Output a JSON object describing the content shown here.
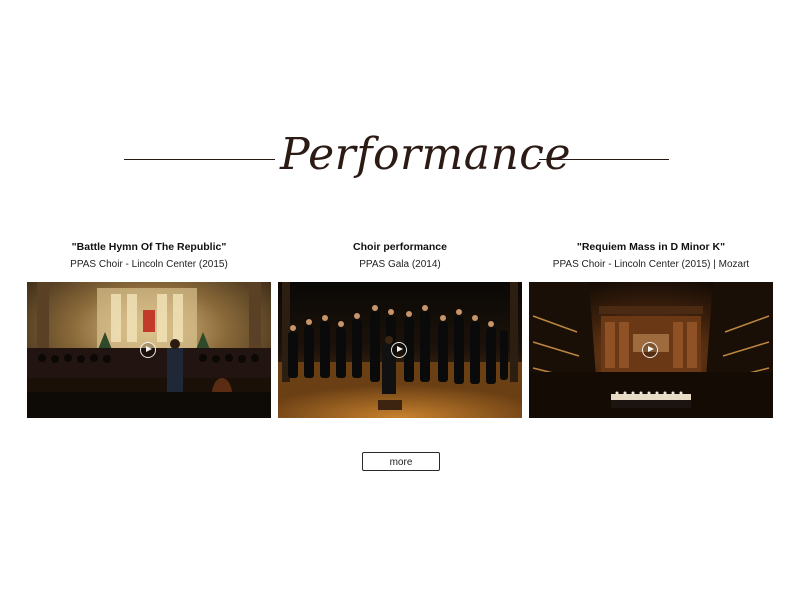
{
  "section": {
    "title": "Performance"
  },
  "videos": [
    {
      "title": "\"Battle Hymn Of The Republic\"",
      "subtitle": "PPAS Choir - Lincoln Center (2015)",
      "thumbnail_icon": "play-icon"
    },
    {
      "title": "Choir performance",
      "subtitle": "PPAS Gala (2014)",
      "thumbnail_icon": "play-icon"
    },
    {
      "title": "\"Requiem Mass in D Minor K\"",
      "subtitle": "PPAS Choir - Lincoln Center (2015) | Mozart",
      "thumbnail_icon": "play-icon"
    }
  ],
  "more_button": {
    "label": "more"
  }
}
